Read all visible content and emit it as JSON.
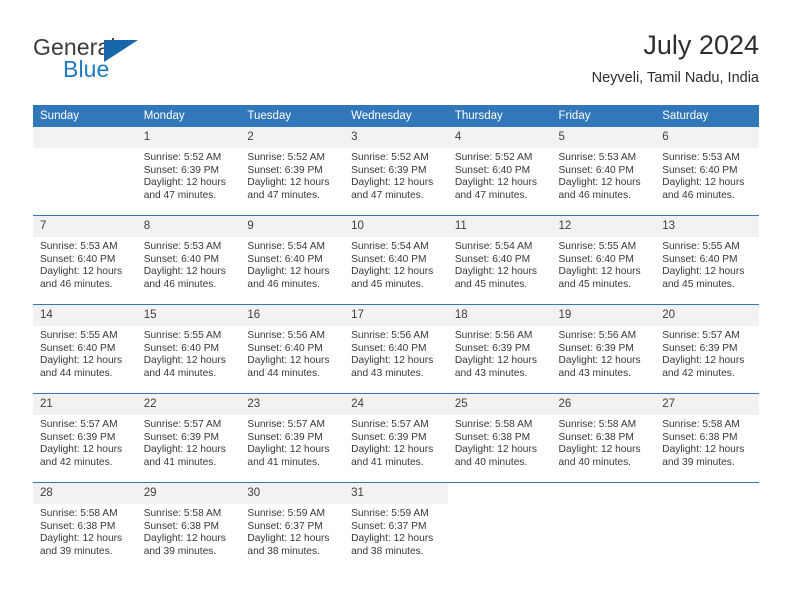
{
  "brand": {
    "name_part1": "General",
    "name_part2": "Blue",
    "logo_icon": "blue-triangle-icon"
  },
  "header": {
    "title": "July 2024",
    "location": "Neyveli, Tamil Nadu, India"
  },
  "colors": {
    "header_blue": "#3277b9",
    "brand_blue": "#1f7ac4",
    "daynum_bg": "#f2f2f2",
    "text": "#38383a"
  },
  "weekday_headers": [
    "Sunday",
    "Monday",
    "Tuesday",
    "Wednesday",
    "Thursday",
    "Friday",
    "Saturday"
  ],
  "weeks": [
    [
      {
        "day": "",
        "empty": true,
        "sunrise": "",
        "sunset": "",
        "daylight1": "",
        "daylight2": ""
      },
      {
        "day": "1",
        "sunrise": "Sunrise: 5:52 AM",
        "sunset": "Sunset: 6:39 PM",
        "daylight1": "Daylight: 12 hours",
        "daylight2": "and 47 minutes."
      },
      {
        "day": "2",
        "sunrise": "Sunrise: 5:52 AM",
        "sunset": "Sunset: 6:39 PM",
        "daylight1": "Daylight: 12 hours",
        "daylight2": "and 47 minutes."
      },
      {
        "day": "3",
        "sunrise": "Sunrise: 5:52 AM",
        "sunset": "Sunset: 6:39 PM",
        "daylight1": "Daylight: 12 hours",
        "daylight2": "and 47 minutes."
      },
      {
        "day": "4",
        "sunrise": "Sunrise: 5:52 AM",
        "sunset": "Sunset: 6:40 PM",
        "daylight1": "Daylight: 12 hours",
        "daylight2": "and 47 minutes."
      },
      {
        "day": "5",
        "sunrise": "Sunrise: 5:53 AM",
        "sunset": "Sunset: 6:40 PM",
        "daylight1": "Daylight: 12 hours",
        "daylight2": "and 46 minutes."
      },
      {
        "day": "6",
        "sunrise": "Sunrise: 5:53 AM",
        "sunset": "Sunset: 6:40 PM",
        "daylight1": "Daylight: 12 hours",
        "daylight2": "and 46 minutes."
      }
    ],
    [
      {
        "day": "7",
        "sunrise": "Sunrise: 5:53 AM",
        "sunset": "Sunset: 6:40 PM",
        "daylight1": "Daylight: 12 hours",
        "daylight2": "and 46 minutes."
      },
      {
        "day": "8",
        "sunrise": "Sunrise: 5:53 AM",
        "sunset": "Sunset: 6:40 PM",
        "daylight1": "Daylight: 12 hours",
        "daylight2": "and 46 minutes."
      },
      {
        "day": "9",
        "sunrise": "Sunrise: 5:54 AM",
        "sunset": "Sunset: 6:40 PM",
        "daylight1": "Daylight: 12 hours",
        "daylight2": "and 46 minutes."
      },
      {
        "day": "10",
        "sunrise": "Sunrise: 5:54 AM",
        "sunset": "Sunset: 6:40 PM",
        "daylight1": "Daylight: 12 hours",
        "daylight2": "and 45 minutes."
      },
      {
        "day": "11",
        "sunrise": "Sunrise: 5:54 AM",
        "sunset": "Sunset: 6:40 PM",
        "daylight1": "Daylight: 12 hours",
        "daylight2": "and 45 minutes."
      },
      {
        "day": "12",
        "sunrise": "Sunrise: 5:55 AM",
        "sunset": "Sunset: 6:40 PM",
        "daylight1": "Daylight: 12 hours",
        "daylight2": "and 45 minutes."
      },
      {
        "day": "13",
        "sunrise": "Sunrise: 5:55 AM",
        "sunset": "Sunset: 6:40 PM",
        "daylight1": "Daylight: 12 hours",
        "daylight2": "and 45 minutes."
      }
    ],
    [
      {
        "day": "14",
        "sunrise": "Sunrise: 5:55 AM",
        "sunset": "Sunset: 6:40 PM",
        "daylight1": "Daylight: 12 hours",
        "daylight2": "and 44 minutes."
      },
      {
        "day": "15",
        "sunrise": "Sunrise: 5:55 AM",
        "sunset": "Sunset: 6:40 PM",
        "daylight1": "Daylight: 12 hours",
        "daylight2": "and 44 minutes."
      },
      {
        "day": "16",
        "sunrise": "Sunrise: 5:56 AM",
        "sunset": "Sunset: 6:40 PM",
        "daylight1": "Daylight: 12 hours",
        "daylight2": "and 44 minutes."
      },
      {
        "day": "17",
        "sunrise": "Sunrise: 5:56 AM",
        "sunset": "Sunset: 6:40 PM",
        "daylight1": "Daylight: 12 hours",
        "daylight2": "and 43 minutes."
      },
      {
        "day": "18",
        "sunrise": "Sunrise: 5:56 AM",
        "sunset": "Sunset: 6:39 PM",
        "daylight1": "Daylight: 12 hours",
        "daylight2": "and 43 minutes."
      },
      {
        "day": "19",
        "sunrise": "Sunrise: 5:56 AM",
        "sunset": "Sunset: 6:39 PM",
        "daylight1": "Daylight: 12 hours",
        "daylight2": "and 43 minutes."
      },
      {
        "day": "20",
        "sunrise": "Sunrise: 5:57 AM",
        "sunset": "Sunset: 6:39 PM",
        "daylight1": "Daylight: 12 hours",
        "daylight2": "and 42 minutes."
      }
    ],
    [
      {
        "day": "21",
        "sunrise": "Sunrise: 5:57 AM",
        "sunset": "Sunset: 6:39 PM",
        "daylight1": "Daylight: 12 hours",
        "daylight2": "and 42 minutes."
      },
      {
        "day": "22",
        "sunrise": "Sunrise: 5:57 AM",
        "sunset": "Sunset: 6:39 PM",
        "daylight1": "Daylight: 12 hours",
        "daylight2": "and 41 minutes."
      },
      {
        "day": "23",
        "sunrise": "Sunrise: 5:57 AM",
        "sunset": "Sunset: 6:39 PM",
        "daylight1": "Daylight: 12 hours",
        "daylight2": "and 41 minutes."
      },
      {
        "day": "24",
        "sunrise": "Sunrise: 5:57 AM",
        "sunset": "Sunset: 6:39 PM",
        "daylight1": "Daylight: 12 hours",
        "daylight2": "and 41 minutes."
      },
      {
        "day": "25",
        "sunrise": "Sunrise: 5:58 AM",
        "sunset": "Sunset: 6:38 PM",
        "daylight1": "Daylight: 12 hours",
        "daylight2": "and 40 minutes."
      },
      {
        "day": "26",
        "sunrise": "Sunrise: 5:58 AM",
        "sunset": "Sunset: 6:38 PM",
        "daylight1": "Daylight: 12 hours",
        "daylight2": "and 40 minutes."
      },
      {
        "day": "27",
        "sunrise": "Sunrise: 5:58 AM",
        "sunset": "Sunset: 6:38 PM",
        "daylight1": "Daylight: 12 hours",
        "daylight2": "and 39 minutes."
      }
    ],
    [
      {
        "day": "28",
        "sunrise": "Sunrise: 5:58 AM",
        "sunset": "Sunset: 6:38 PM",
        "daylight1": "Daylight: 12 hours",
        "daylight2": "and 39 minutes."
      },
      {
        "day": "29",
        "sunrise": "Sunrise: 5:58 AM",
        "sunset": "Sunset: 6:38 PM",
        "daylight1": "Daylight: 12 hours",
        "daylight2": "and 39 minutes."
      },
      {
        "day": "30",
        "sunrise": "Sunrise: 5:59 AM",
        "sunset": "Sunset: 6:37 PM",
        "daylight1": "Daylight: 12 hours",
        "daylight2": "and 38 minutes."
      },
      {
        "day": "31",
        "sunrise": "Sunrise: 5:59 AM",
        "sunset": "Sunset: 6:37 PM",
        "daylight1": "Daylight: 12 hours",
        "daylight2": "and 38 minutes."
      },
      {
        "day": "",
        "off": true,
        "sunrise": "",
        "sunset": "",
        "daylight1": "",
        "daylight2": ""
      },
      {
        "day": "",
        "off": true,
        "sunrise": "",
        "sunset": "",
        "daylight1": "",
        "daylight2": ""
      },
      {
        "day": "",
        "off": true,
        "sunrise": "",
        "sunset": "",
        "daylight1": "",
        "daylight2": ""
      }
    ]
  ]
}
